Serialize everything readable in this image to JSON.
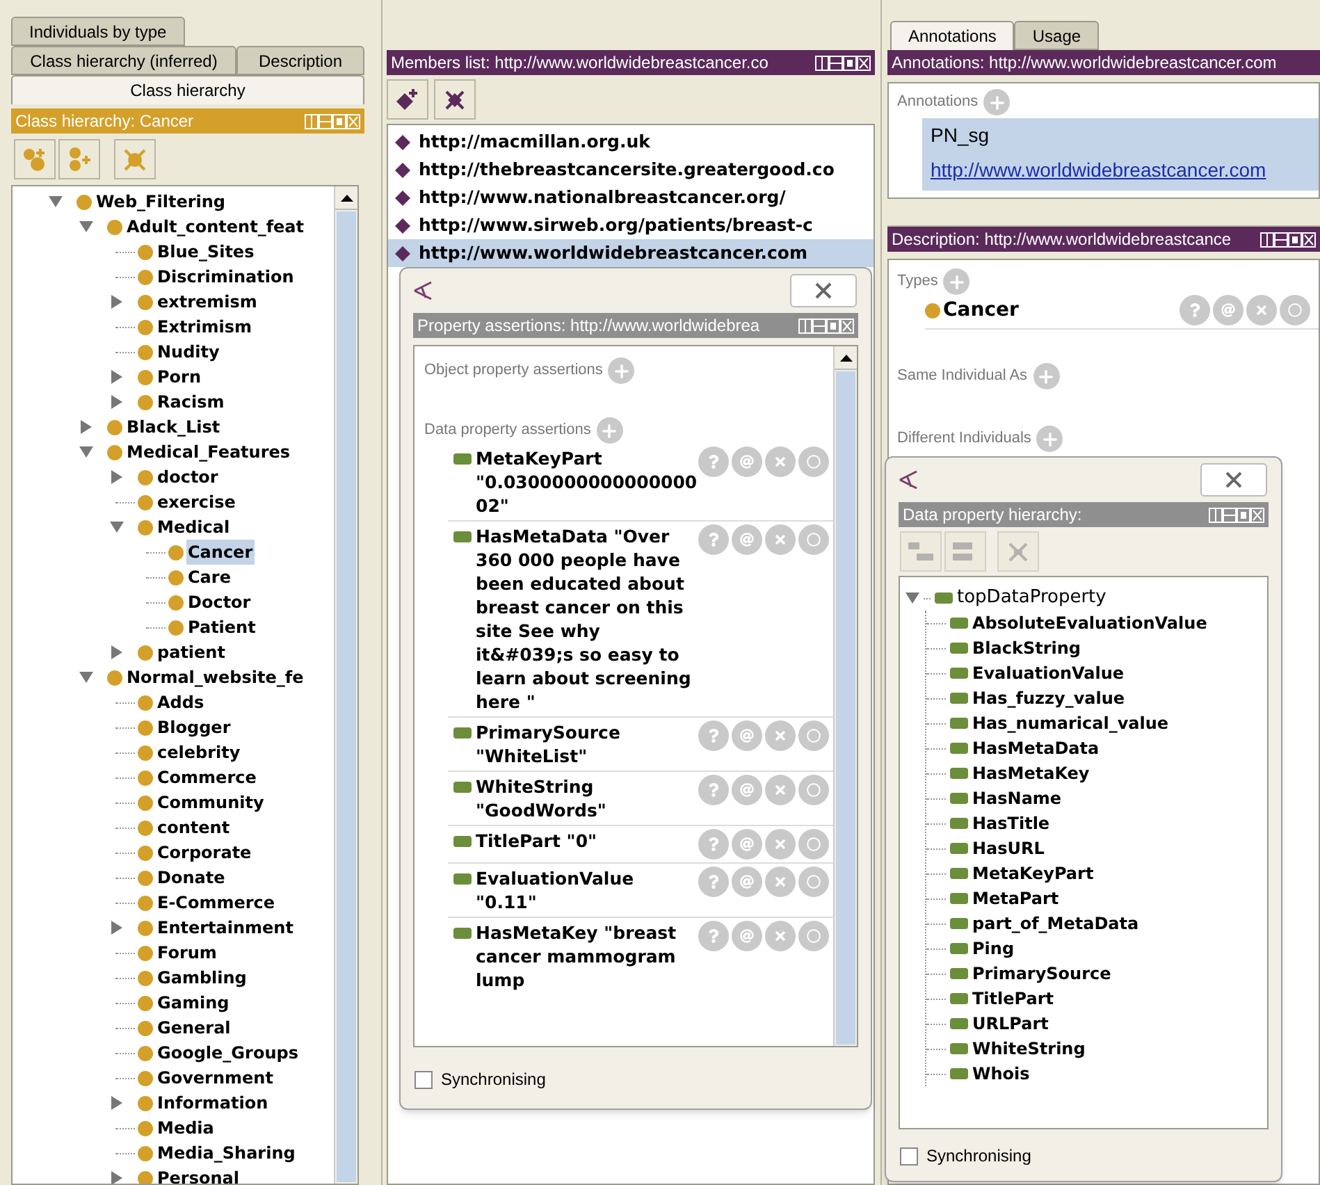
{
  "left_panel": {
    "tabs": [
      [
        {
          "label": "Individuals by type",
          "selected": false
        }
      ],
      [
        {
          "label": "Class hierarchy (inferred)",
          "selected": false
        },
        {
          "label": "Description",
          "selected": false
        }
      ],
      [
        {
          "label": "Class hierarchy",
          "selected": true
        }
      ]
    ],
    "header": "Class hierarchy: Cancer",
    "tree": [
      {
        "label": "Web_Filtering",
        "expanded": true,
        "selected": false,
        "children": [
          {
            "label": "Adult_content_feat",
            "expanded": true,
            "selected": false,
            "children": [
              {
                "label": "Blue_Sites",
                "selected": false
              },
              {
                "label": "Discrimination",
                "selected": false
              },
              {
                "label": "extremism",
                "expanded": false,
                "selected": false
              },
              {
                "label": "Extrimism",
                "selected": false
              },
              {
                "label": "Nudity",
                "selected": false
              },
              {
                "label": "Porn",
                "expanded": false,
                "selected": false
              },
              {
                "label": "Racism",
                "expanded": false,
                "selected": false
              }
            ]
          },
          {
            "label": "Black_List",
            "expanded": false,
            "selected": false
          },
          {
            "label": "Medical_Features",
            "expanded": true,
            "selected": false,
            "children": [
              {
                "label": "doctor",
                "expanded": false,
                "selected": false
              },
              {
                "label": "exercise",
                "selected": false
              },
              {
                "label": "Medical",
                "expanded": true,
                "selected": false,
                "children": [
                  {
                    "label": "Cancer",
                    "selected": true
                  },
                  {
                    "label": "Care",
                    "selected": false
                  },
                  {
                    "label": "Doctor",
                    "selected": false
                  },
                  {
                    "label": "Patient",
                    "selected": false
                  }
                ]
              },
              {
                "label": "patient",
                "expanded": false,
                "selected": false
              }
            ]
          },
          {
            "label": "Normal_website_fe",
            "expanded": true,
            "selected": false,
            "children": [
              {
                "label": "Adds",
                "selected": false
              },
              {
                "label": "Blogger",
                "selected": false
              },
              {
                "label": "celebrity",
                "selected": false
              },
              {
                "label": "Commerce",
                "selected": false
              },
              {
                "label": "Community",
                "selected": false
              },
              {
                "label": "content",
                "selected": false
              },
              {
                "label": "Corporate",
                "selected": false
              },
              {
                "label": "Donate",
                "selected": false
              },
              {
                "label": "E-Commerce",
                "selected": false
              },
              {
                "label": "Entertainment",
                "expanded": false,
                "selected": false
              },
              {
                "label": "Forum",
                "selected": false
              },
              {
                "label": "Gambling",
                "selected": false
              },
              {
                "label": "Gaming",
                "selected": false
              },
              {
                "label": "General",
                "selected": false
              },
              {
                "label": "Google_Groups",
                "selected": false
              },
              {
                "label": "Government",
                "selected": false
              },
              {
                "label": "Information",
                "expanded": false,
                "selected": false
              },
              {
                "label": "Media",
                "selected": false
              },
              {
                "label": "Media_Sharing",
                "selected": false
              },
              {
                "label": "Personal",
                "expanded": false,
                "selected": false
              }
            ]
          }
        ]
      }
    ]
  },
  "members": {
    "header": "Members list: http://www.worldwidebreastcancer.co",
    "items": [
      {
        "label": "http://macmillan.org.uk",
        "selected": false
      },
      {
        "label": "http://thebreastcancersite.greatergood.co",
        "selected": false
      },
      {
        "label": "http://www.nationalbreastcancer.org/",
        "selected": false
      },
      {
        "label": "http://www.sirweb.org/patients/breast-c",
        "selected": false
      },
      {
        "label": "http://www.worldwidebreastcancer.com",
        "selected": true
      }
    ]
  },
  "property_dialog": {
    "header": "Property assertions: http://www.worldwidebrea",
    "object_section": "Object property assertions",
    "data_section": "Data property assertions",
    "assertions": [
      {
        "property": "MetaKeyPart",
        "value": "\"0.030000000000000002\""
      },
      {
        "property": "HasMetaData",
        "value": "\"Over 360 000 people have been educated about breast cancer on this site  See why it&#039;s so easy to learn about screening here \""
      },
      {
        "property": "PrimarySource",
        "value": "\"WhiteList\""
      },
      {
        "property": "WhiteString",
        "value": "\"GoodWords\""
      },
      {
        "property": "TitlePart",
        "value": "\"0\""
      },
      {
        "property": "EvaluationValue",
        "value": "\"0.11\""
      },
      {
        "property": "HasMetaKey",
        "value": "\"breast cancer mammogram  lump"
      }
    ],
    "sync": {
      "label": "Synchronising",
      "checked": false
    }
  },
  "right_panel": {
    "tabs": [
      {
        "label": "Annotations",
        "selected": true
      },
      {
        "label": "Usage",
        "selected": false
      }
    ],
    "annotations_header": "Annotations: http://www.worldwidebreastcancer.com",
    "annotations_label": "Annotations",
    "annotation": {
      "property": "PN_sg",
      "value": "http://www.worldwidebreastcancer.com"
    },
    "description_header": "Description: http://www.worldwidebreastcance",
    "types_label": "Types",
    "types": [
      {
        "label": "Cancer"
      }
    ],
    "same_individual_label": "Same Individual As",
    "different_individuals_label": "Different Individuals"
  },
  "data_property_dialog": {
    "header": "Data property hierarchy:",
    "tree": {
      "label": "topDataProperty",
      "expanded": true,
      "children": [
        "AbsoluteEvaluationValue",
        "BlackString",
        "EvaluationValue",
        "Has_fuzzy_value",
        "Has_numarical_value",
        "HasMetaData",
        "HasMetaKey",
        "HasName",
        "HasTitle",
        "HasURL",
        "MetaKeyPart",
        "MetaPart",
        "part_of_MetaData",
        "Ping",
        "PrimarySource",
        "TitlePart",
        "URLPart",
        "WhiteString",
        "Whois"
      ]
    },
    "sync": {
      "label": "Synchronising",
      "checked": false
    }
  }
}
